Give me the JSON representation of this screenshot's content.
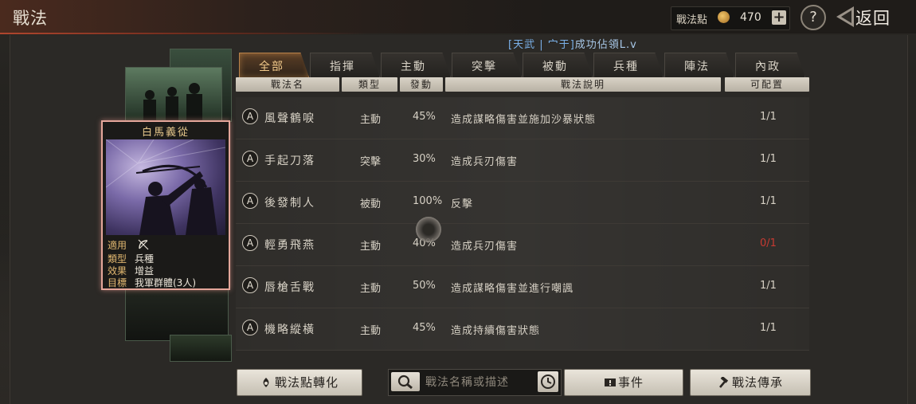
{
  "header": {
    "title": "戰法",
    "points_label": "戰法點",
    "points_value": "470",
    "plus_label": "+",
    "help_label": "?",
    "back_label": "返回"
  },
  "marquee": {
    "bracket_text": "[天武 | 宀于]",
    "text": "成功佔領L.v"
  },
  "tabs": [
    {
      "label": "全部",
      "active": true
    },
    {
      "label": "指揮",
      "active": false
    },
    {
      "label": "主動",
      "active": false
    },
    {
      "label": "突擊",
      "active": false
    },
    {
      "label": "被動",
      "active": false
    },
    {
      "label": "兵種",
      "active": false
    },
    {
      "label": "陣法",
      "active": false
    },
    {
      "label": "內政",
      "active": false
    }
  ],
  "table": {
    "headers": [
      "戰法名",
      "類型",
      "發動",
      "戰法說明",
      "可配置"
    ],
    "rows": [
      {
        "grade": "A",
        "name": "風聲鶴唳",
        "type": "主動",
        "rate": "45%",
        "desc": "造成謀略傷害並施加沙暴狀態",
        "slots": "1/1",
        "slots_warning": false
      },
      {
        "grade": "A",
        "name": "手起刀落",
        "type": "突擊",
        "rate": "30%",
        "desc": "造成兵刃傷害",
        "slots": "1/1",
        "slots_warning": false
      },
      {
        "grade": "A",
        "name": "後發制人",
        "type": "被動",
        "rate": "100%",
        "desc": "反擊",
        "slots": "1/1",
        "slots_warning": false
      },
      {
        "grade": "A",
        "name": "輕勇飛燕",
        "type": "主動",
        "rate": "40%",
        "desc": "造成兵刃傷害",
        "slots": "0/1",
        "slots_warning": true
      },
      {
        "grade": "A",
        "name": "唇槍舌戰",
        "type": "主動",
        "rate": "50%",
        "desc": "造成謀略傷害並進行嘲諷",
        "slots": "1/1",
        "slots_warning": false
      },
      {
        "grade": "A",
        "name": "機略縱橫",
        "type": "主動",
        "rate": "45%",
        "desc": "造成持續傷害狀態",
        "slots": "1/1",
        "slots_warning": false
      }
    ]
  },
  "card": {
    "title": "白馬義從",
    "info": [
      {
        "key": "適用",
        "value": "",
        "icon": "bow-icon"
      },
      {
        "key": "類型",
        "value": "兵種"
      },
      {
        "key": "效果",
        "value": "增益"
      },
      {
        "key": "目標",
        "value": "我軍群體(3人)"
      }
    ]
  },
  "bottom": {
    "convert_label": "戰法點轉化",
    "search_placeholder": "戰法名稱或描述",
    "events_label": "事件",
    "inherit_label": "戰法傳承"
  },
  "colors": {
    "accent": "#f2c98a",
    "card_border": "#e4a69a",
    "warning": "#c73a32",
    "marquee": "#a8c8e8"
  },
  "icons": [
    "ink-points-icon",
    "plus-icon",
    "help-icon",
    "back-arrow-icon",
    "bow-icon",
    "search-icon",
    "clock-icon",
    "gem-icon",
    "event-icon",
    "hammer-icon",
    "loading-spinner"
  ]
}
